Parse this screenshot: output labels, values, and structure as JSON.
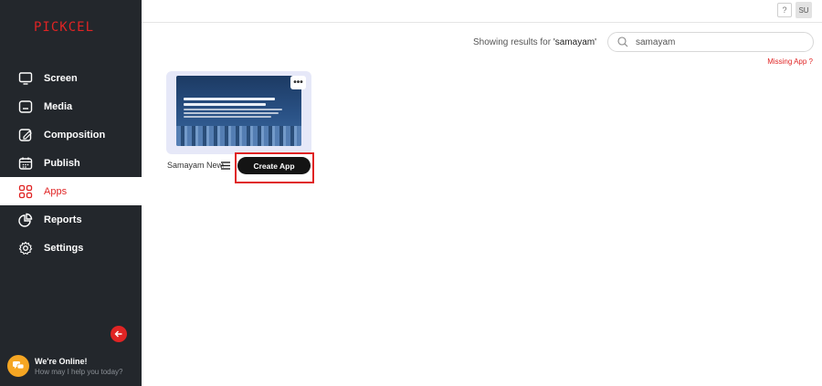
{
  "brand": {
    "logo_text": "PICKCEL",
    "accent_color": "#e02424"
  },
  "sidebar": {
    "items": [
      {
        "label": "Screen",
        "icon": "monitor-icon"
      },
      {
        "label": "Media",
        "icon": "media-icon"
      },
      {
        "label": "Composition",
        "icon": "edit-icon"
      },
      {
        "label": "Publish",
        "icon": "calendar-icon"
      },
      {
        "label": "Apps",
        "icon": "apps-grid-icon",
        "active": true
      },
      {
        "label": "Reports",
        "icon": "pie-chart-icon"
      },
      {
        "label": "Settings",
        "icon": "gear-icon"
      }
    ],
    "collapse_icon": "arrow-left-icon"
  },
  "chat": {
    "title": "We're Online!",
    "subtitle": "How may I help you today?"
  },
  "topbar": {
    "help_label": "?",
    "user_initials": "SU"
  },
  "search": {
    "results_prefix": "Showing results for ",
    "query_display": "'samayam'",
    "value": "samayam",
    "missing_label": "Missing App ?"
  },
  "app_card": {
    "name": "Samayam News",
    "dots_label": "•••",
    "create_label": "Create App"
  }
}
